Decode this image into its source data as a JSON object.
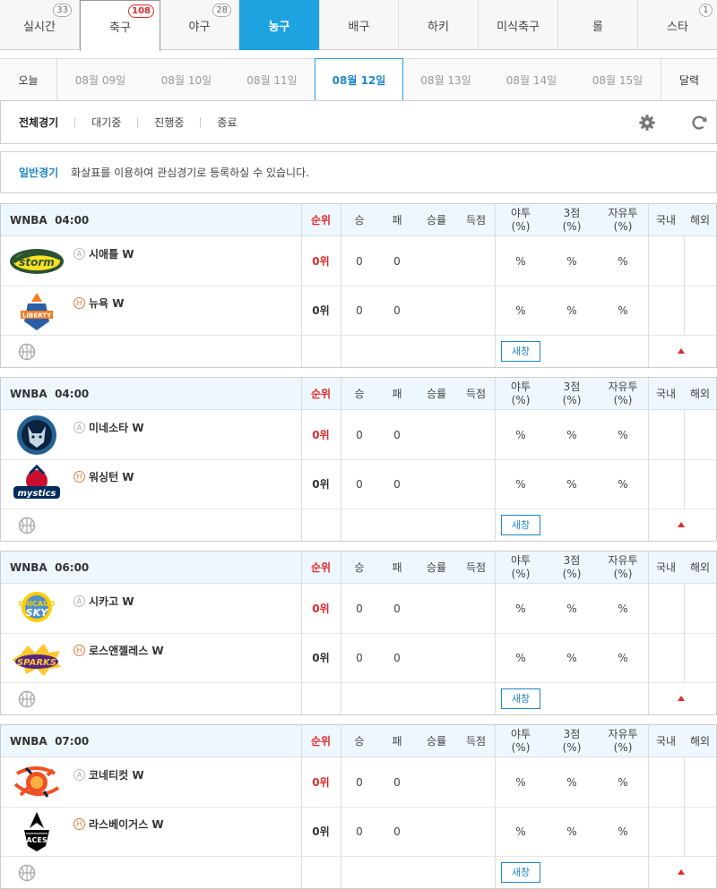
{
  "sport_tabs": [
    {
      "label": "실시간",
      "badge": "33"
    },
    {
      "label": "축구",
      "badge": "108"
    },
    {
      "label": "야구",
      "badge": "28"
    },
    {
      "label": "농구",
      "badge": ""
    },
    {
      "label": "배구",
      "badge": ""
    },
    {
      "label": "하키",
      "badge": ""
    },
    {
      "label": "미식축구",
      "badge": ""
    },
    {
      "label": "롤",
      "badge": ""
    },
    {
      "label": "스타",
      "badge": "1"
    }
  ],
  "date_tabs": [
    "오늘",
    "08월 09일",
    "08월 10일",
    "08월 11일",
    "08월 12일",
    "08월 13일",
    "08월 14일",
    "08월 15일",
    "달력"
  ],
  "filters": [
    "전체경기",
    "대기중",
    "진행중",
    "종료"
  ],
  "info": {
    "label": "일반경기",
    "text": "화살표를 이용하여 관심경기로 등록하실 수 있습니다."
  },
  "columns": {
    "rank": "순위",
    "win": "승",
    "loss": "패",
    "pct": "승률",
    "pts": "득점",
    "fg1": "야투",
    "fg2": "(%)",
    "tp1": "3점",
    "tp2": "(%)",
    "ft1": "자유투",
    "ft2": "(%)",
    "domestic": "국내",
    "overseas": "해외"
  },
  "new_window_label": "새창",
  "games": [
    {
      "league": "WNBA",
      "time": "04:00",
      "away": {
        "name": "시애틀 W",
        "ha": "A",
        "rank": "0위",
        "win": "0",
        "loss": "0",
        "fg": "%",
        "tp": "%",
        "ft": "%",
        "logo": "storm-logo"
      },
      "home": {
        "name": "뉴욕 W",
        "ha": "H",
        "rank": "0위",
        "win": "0",
        "loss": "0",
        "fg": "%",
        "tp": "%",
        "ft": "%",
        "logo": "liberty-logo"
      }
    },
    {
      "league": "WNBA",
      "time": "04:00",
      "away": {
        "name": "미네소타 W",
        "ha": "A",
        "rank": "0위",
        "win": "0",
        "loss": "0",
        "fg": "%",
        "tp": "%",
        "ft": "%",
        "logo": "lynx-logo"
      },
      "home": {
        "name": "워싱턴 W",
        "ha": "H",
        "rank": "0위",
        "win": "0",
        "loss": "0",
        "fg": "%",
        "tp": "%",
        "ft": "%",
        "logo": "mystics-logo"
      }
    },
    {
      "league": "WNBA",
      "time": "06:00",
      "away": {
        "name": "시카고 W",
        "ha": "A",
        "rank": "0위",
        "win": "0",
        "loss": "0",
        "fg": "%",
        "tp": "%",
        "ft": "%",
        "logo": "sky-logo"
      },
      "home": {
        "name": "로스앤젤레스 W",
        "ha": "H",
        "rank": "0위",
        "win": "0",
        "loss": "0",
        "fg": "%",
        "tp": "%",
        "ft": "%",
        "logo": "sparks-logo"
      }
    },
    {
      "league": "WNBA",
      "time": "07:00",
      "away": {
        "name": "코네티컷 W",
        "ha": "A",
        "rank": "0위",
        "win": "0",
        "loss": "0",
        "fg": "%",
        "tp": "%",
        "ft": "%",
        "logo": "sun-logo"
      },
      "home": {
        "name": "라스베이거스 W",
        "ha": "H",
        "rank": "0위",
        "win": "0",
        "loss": "0",
        "fg": "%",
        "tp": "%",
        "ft": "%",
        "logo": "aces-logo"
      }
    }
  ]
}
